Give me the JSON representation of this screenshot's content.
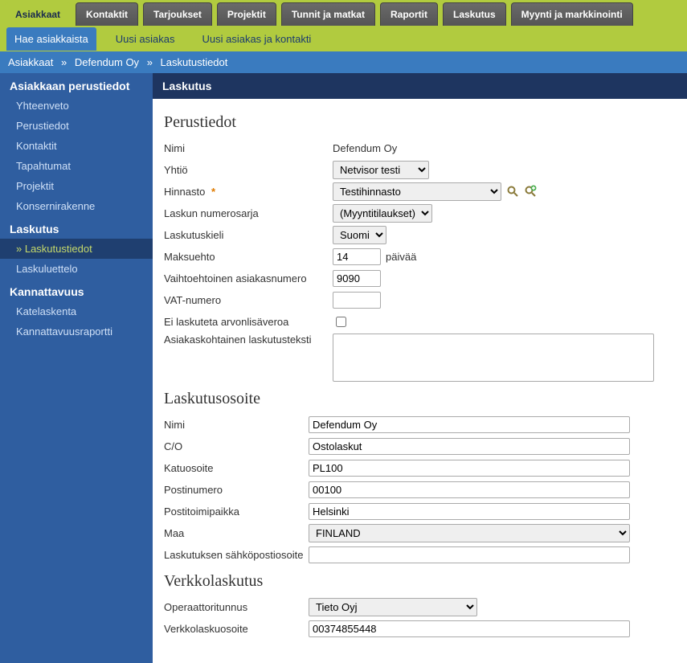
{
  "top_tabs": {
    "items": [
      {
        "label": "Asiakkaat",
        "active": true
      },
      {
        "label": "Kontaktit"
      },
      {
        "label": "Tarjoukset"
      },
      {
        "label": "Projektit"
      },
      {
        "label": "Tunnit ja matkat"
      },
      {
        "label": "Raportit"
      },
      {
        "label": "Laskutus"
      },
      {
        "label": "Myynti ja markkinointi"
      }
    ]
  },
  "sub_nav": {
    "items": [
      {
        "label": "Hae asiakkaista",
        "highlight": true
      },
      {
        "label": "Uusi asiakas"
      },
      {
        "label": "Uusi asiakas ja kontakti"
      }
    ]
  },
  "breadcrumb": {
    "a": "Asiakkaat",
    "b": "Defendum Oy",
    "c": "Laskutustiedot"
  },
  "sidebar": {
    "group1_title": "Asiakkaan perustiedot",
    "group1_items": [
      "Yhteenveto",
      "Perustiedot",
      "Kontaktit",
      "Tapahtumat",
      "Projektit",
      "Konsernirakenne"
    ],
    "group2_title": "Laskutus",
    "group2_items": [
      {
        "label": "Laskutustiedot",
        "active": true
      },
      {
        "label": "Laskuluettelo"
      }
    ],
    "group3_title": "Kannattavuus",
    "group3_items": [
      "Katelaskenta",
      "Kannattavuusraportti"
    ]
  },
  "panel": {
    "title": "Laskutus"
  },
  "sections": {
    "perustiedot": "Perustiedot",
    "laskutusosoite": "Laskutusosoite",
    "verkkolaskutus": "Verkkolaskutus"
  },
  "perustiedot": {
    "nimi_label": "Nimi",
    "nimi_value": "Defendum Oy",
    "yhtio_label": "Yhtiö",
    "yhtio_value": "Netvisor testi",
    "hinnasto_label": "Hinnasto",
    "hinnasto_value": "Testihinnasto",
    "laskun_numerosarja_label": "Laskun numerosarja",
    "laskun_numerosarja_value": "(Myyntitilaukset)",
    "laskutuskieli_label": "Laskutuskieli",
    "laskutuskieli_value": "Suomi",
    "maksuehto_label": "Maksuehto",
    "maksuehto_value": "14",
    "maksuehto_suffix": "päivää",
    "vaihtoehtoinen_label": "Vaihtoehtoinen asiakasnumero",
    "vaihtoehtoinen_value": "9090",
    "vat_label": "VAT-numero",
    "vat_value": "",
    "eilaskuteta_label": "Ei laskuteta arvonlisäveroa",
    "asiakaskohtainen_label": "Asiakaskohtainen laskutusteksti",
    "asiakaskohtainen_value": ""
  },
  "laskutusosoite": {
    "nimi_label": "Nimi",
    "nimi_value": "Defendum Oy",
    "co_label": "C/O",
    "co_value": "Ostolaskut",
    "katu_label": "Katuosoite",
    "katu_value": "PL100",
    "postinro_label": "Postinumero",
    "postinro_value": "00100",
    "postitoimi_label": "Postitoimipaikka",
    "postitoimi_value": "Helsinki",
    "maa_label": "Maa",
    "maa_value": "FINLAND",
    "email_label": "Laskutuksen sähköpostiosoite",
    "email_value": ""
  },
  "verkkolaskutus": {
    "operaattori_label": "Operaattoritunnus",
    "operaattori_value": "Tieto Oyj",
    "osoite_label": "Verkkolaskuosoite",
    "osoite_value": "00374855448"
  },
  "icons": {
    "search": "search-icon",
    "add": "add-icon"
  }
}
